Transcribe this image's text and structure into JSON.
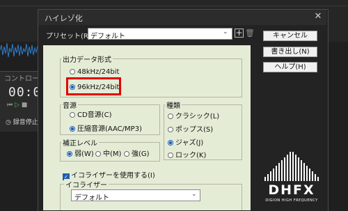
{
  "background": {
    "control_title": "コントロー",
    "time_display": "00:00",
    "transport": [
      "⏮",
      "▷",
      "■"
    ],
    "timer_label": "録音停止タ"
  },
  "dialog": {
    "title": "ハイレゾ化",
    "close_glyph": "✕",
    "preset_label": "プリセット(R):",
    "preset_value": "デフォルト",
    "preset_add_glyph": "+",
    "preset_delete_glyph": "🗑",
    "buttons": {
      "cancel": "キャンセル",
      "save": "書き出し(N)",
      "help": "ヘルプ(H)"
    },
    "output_format": {
      "label": "出力データ形式",
      "options": [
        "48kHz/24bit",
        "96kHz/24bit"
      ],
      "selected": "96kHz/24bit"
    },
    "source": {
      "label": "音源",
      "options": [
        "CD音源(C)",
        "圧縮音源(AAC/MP3)"
      ],
      "selected": "圧縮音源(AAC/MP3)"
    },
    "genre": {
      "label": "種類",
      "options": [
        "クラシック(L)",
        "ポップス(S)",
        "ジャズ(J)",
        "ロック(K)"
      ],
      "selected": "ジャズ(J)"
    },
    "correction": {
      "label": "補正レベル",
      "options": [
        "弱(W)",
        "中(M)",
        "強(G)"
      ],
      "selected": "弱(W)"
    },
    "equalizer": {
      "use_label": "イコライザーを使用する(I)",
      "checked": true,
      "group_label": "イコライザー",
      "value": "デフォルト"
    },
    "logo": {
      "name": "DHFX",
      "tagline": "DIGION HIGH FREQUENCY"
    }
  },
  "colors": {
    "highlight": "#e30000",
    "panel": "#e5ecd6",
    "accent": "#1f5fb0"
  }
}
